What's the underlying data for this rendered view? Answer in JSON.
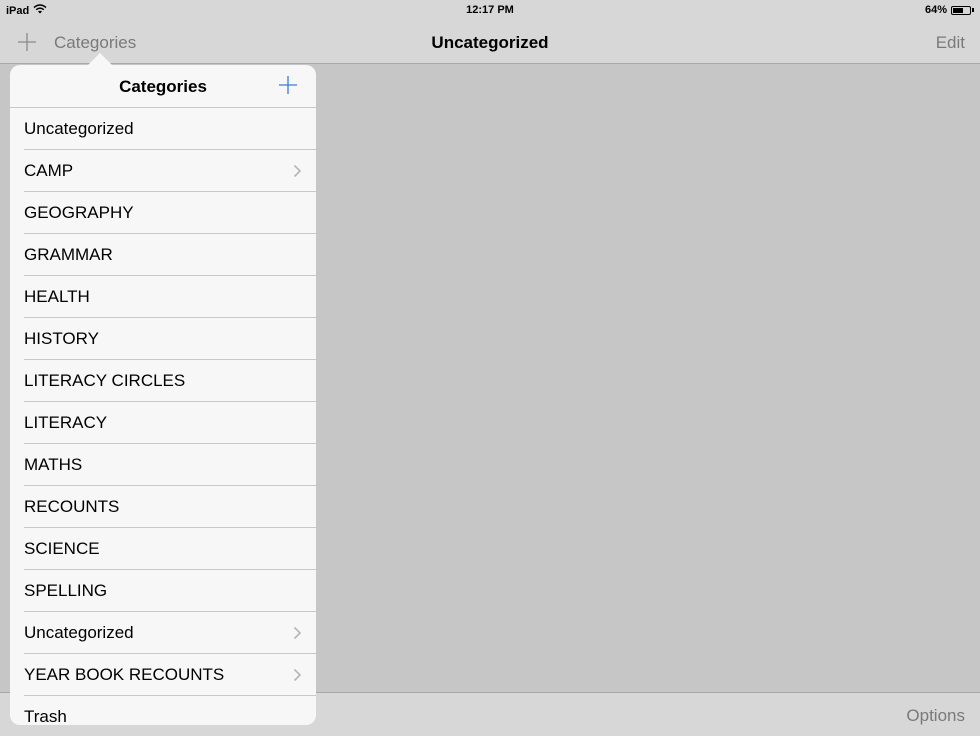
{
  "status_bar": {
    "device": "iPad",
    "time": "12:17 PM",
    "battery": "64%",
    "battery_level": 0.64
  },
  "nav_bar": {
    "categories_label": "Categories",
    "title": "Uncategorized",
    "edit_label": "Edit"
  },
  "popover": {
    "title": "Categories",
    "items": [
      {
        "label": "Uncategorized",
        "has_chevron": false
      },
      {
        "label": "CAMP",
        "has_chevron": true
      },
      {
        "label": "GEOGRAPHY",
        "has_chevron": false
      },
      {
        "label": "GRAMMAR",
        "has_chevron": false
      },
      {
        "label": "HEALTH",
        "has_chevron": false
      },
      {
        "label": "HISTORY",
        "has_chevron": false
      },
      {
        "label": "LITERACY CIRCLES",
        "has_chevron": false
      },
      {
        "label": "LITERACY",
        "has_chevron": false
      },
      {
        "label": "MATHS",
        "has_chevron": false
      },
      {
        "label": "RECOUNTS",
        "has_chevron": false
      },
      {
        "label": "SCIENCE",
        "has_chevron": false
      },
      {
        "label": "SPELLING",
        "has_chevron": false
      },
      {
        "label": "Uncategorized",
        "has_chevron": true
      },
      {
        "label": "YEAR BOOK RECOUNTS",
        "has_chevron": true
      },
      {
        "label": "Trash",
        "has_chevron": false
      }
    ]
  },
  "bottom_bar": {
    "options_label": "Options"
  },
  "icons": {
    "wifi": "wifi-icon",
    "battery": "battery-icon",
    "add": "plus-icon",
    "chevron": "chevron-right-icon"
  },
  "colors": {
    "bar_background": "#d7d7d7",
    "content_background": "#c6c6c6",
    "popover_background": "#f7f7f7",
    "disabled_text": "#7a7a7a",
    "accent": "#3a7bd5"
  }
}
